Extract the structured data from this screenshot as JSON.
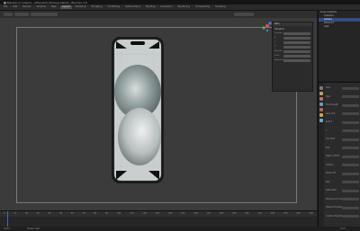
{
  "window": {
    "title": "■ Blender [C:\\Users\\...\\iPhone15_Mockup.blend] - Blender 3.6"
  },
  "menubar": {
    "tabs": [
      {
        "label": "File",
        "active": false
      },
      {
        "label": "Edit",
        "active": false
      },
      {
        "label": "Render",
        "active": false
      },
      {
        "label": "Window",
        "active": false
      },
      {
        "label": "Help",
        "active": false
      },
      {
        "label": "Layout",
        "active": true
      },
      {
        "label": "Modeling",
        "active": false
      },
      {
        "label": "Sculpting",
        "active": false
      },
      {
        "label": "UV Editing",
        "active": false
      },
      {
        "label": "Texture Paint",
        "active": false
      },
      {
        "label": "Shading",
        "active": false
      },
      {
        "label": "Animation",
        "active": false
      },
      {
        "label": "Rendering",
        "active": false
      },
      {
        "label": "Compositing",
        "active": false
      },
      {
        "label": "Scripting",
        "active": false
      }
    ]
  },
  "npanel": {
    "header": "Item",
    "transform_label": "Transform",
    "rows": [
      {
        "label": "Location"
      },
      {
        "label": "X"
      },
      {
        "label": "Y"
      },
      {
        "label": "Z"
      },
      {
        "label": "Rotation"
      },
      {
        "label": "Scale"
      },
      {
        "label": "Dimensions"
      }
    ]
  },
  "outliner": {
    "items": [
      {
        "label": "Scene Collection",
        "selected": false
      },
      {
        "label": "Collection",
        "selected": false
      },
      {
        "label": "Camera",
        "selected": true
      },
      {
        "label": "iPhone 15",
        "selected": false
      },
      {
        "label": "Light",
        "selected": false
      }
    ]
  },
  "properties": {
    "rows": [
      {
        "label": "Lens"
      },
      {
        "label": "Type"
      },
      {
        "label": "Focal Length"
      },
      {
        "label": "Lens Unit"
      },
      {
        "label": "Shift X"
      },
      {
        "label": "Y"
      },
      {
        "label": "Clip Start"
      },
      {
        "label": "End"
      },
      {
        "label": "Depth of Field"
      },
      {
        "label": "Camera"
      },
      {
        "label": "Sensor Fit"
      },
      {
        "label": "Size"
      },
      {
        "label": "Safe Areas"
      },
      {
        "label": "Background Images"
      },
      {
        "label": "Viewport Display"
      },
      {
        "label": "Custom Properties"
      }
    ]
  },
  "timeline": {
    "ticks": [
      "0",
      "10",
      "20",
      "30",
      "40",
      "50",
      "60",
      "70",
      "80",
      "90",
      "100",
      "110",
      "120",
      "130",
      "140",
      "150",
      "160",
      "170",
      "180",
      "190",
      "200",
      "210",
      "220",
      "230",
      "240",
      "250"
    ]
  },
  "statusbar": {
    "left": "Select",
    "mid": "Rotate View",
    "right": "3.6.0"
  },
  "colors": {
    "accent": "#3d6dc4",
    "viewport_bg": "#3b3b3b",
    "phone_frame": "#2a2a2a"
  }
}
